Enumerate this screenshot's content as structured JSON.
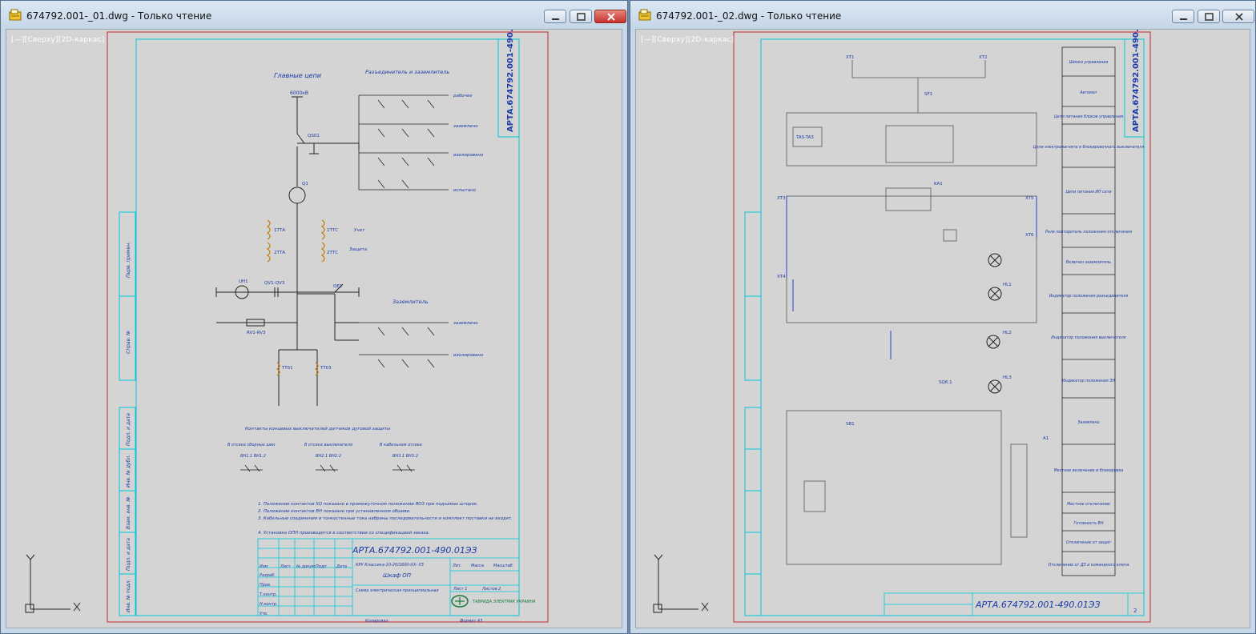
{
  "windows": [
    {
      "title": "674792.001-_01.dwg - Только чтение",
      "view_label": "[—][Сверху][2D-каркас]",
      "drawing": {
        "stamp_code": "АРТА.674792.001-490.01ЭЗ",
        "title_main": "Главные цепи",
        "title_switches": "Разъединитель и заземлитель",
        "title_earth": "Заземлитель",
        "title_contacts": "Контакты концевых выключателей датчиков дуговой защиты",
        "bus_label": "6000кВ",
        "lines_top": [
          "рабочее",
          "заземлено",
          "изолировано",
          "испытано"
        ],
        "lines_bottom": [
          "заземлено",
          "изолировано"
        ],
        "tt_labels": [
          "1ТТА",
          "2ТТА",
          "1ТТС",
          "2ТТС"
        ],
        "meas_labels": [
          "Учет",
          "Защита"
        ],
        "device_labels": [
          "QS01",
          "Q1",
          "QE1",
          "UH1",
          "QV1-QV3",
          "RV1-RV3",
          "TT01",
          "TT03"
        ],
        "contact_groups": [
          "В отсеке сборных шин",
          "В отсеке выключателя",
          "В кабельном отсеке"
        ],
        "contact_tags": [
          "ВН1.1 ВН1.2",
          "ВН2.1 ВН2.2",
          "ВН3.1 ВН3.2"
        ],
        "notes": [
          "1. Положение контактов SQ показано в промежуточном положении ЯОЗ при подъемах шторок.",
          "2. Положение контактов ВН показано при установленном обшиве.",
          "3. Кабельные соединения и тонкостенные тока набраны последовательности и комплект поставки не входят.",
          "4. Установка ОПН производится в соответствии со спецификацией заказа."
        ],
        "stamp_rows": [
          "Разраб.",
          "Пров.",
          "Т.контр.",
          "Н.контр.",
          "Утв."
        ],
        "stamp_head": [
          "Изм",
          "Лист",
          "№ докум.",
          "Подп.",
          "Дата"
        ],
        "stamp_org": "КРУ Классика-10-20/1600-ХХ- УЗ",
        "stamp_name": "Шкаф ОП",
        "stamp_sub": "Схема электрическая принципиальная",
        "stamp_cols": [
          "Лит.",
          "Масса",
          "Масштаб"
        ],
        "stamp_sheet": [
          "Лист 1",
          "Листов 2"
        ],
        "company": "ТАВРИДА ЭЛЕКТРИК УКРАИНА",
        "copied": "Копировал",
        "format": "Формат А3",
        "side_labels": [
          "Перв. примен.",
          "Справ. №",
          "Подп. и дата",
          "Инв. № дубл.",
          "Взам. инв. №",
          "Подп. и дата",
          "Инв. № подл."
        ]
      }
    },
    {
      "title": "674792.001-_02.dwg - Только чтение",
      "view_label": "[—][Сверху][2D-каркас]",
      "drawing": {
        "stamp_code": "АРТА.674792.001-490.01ЭЗ",
        "sheet": "2",
        "right_table": [
          "Шинки управления",
          "Автомат",
          "Цепи питания блоков управления",
          "Цепи электромагнита и блокировочного выключателя",
          "Цепи питания ИП сети",
          "Реле повторитель положения отключения",
          "Включен заземлитель",
          "Индикатор положения разъединителя",
          "Индикатор положения выключателя",
          "Индикатор положения ЗН",
          "Заземлено",
          "Местное включение и блокировка",
          "Местное отключение",
          "Готовность ВН",
          "Отключение от защит",
          "Отключение от ДЗ и командного ключа"
        ],
        "labels": [
          "SF1",
          "TAS-TA3",
          "KA1",
          "XT1",
          "XT2",
          "XT3",
          "XT4",
          "XT5",
          "XT6",
          "HL1",
          "HL2",
          "HL3",
          "SB1",
          "SQ6.1",
          "A1"
        ]
      }
    }
  ],
  "buttons": {
    "minimize": "minimize",
    "maximize": "maximize",
    "close": "close"
  },
  "colors": {
    "title_bg": "#c9d8e8",
    "canvas_bg": "#d4d4d4",
    "frame_red": "#c0282e",
    "frame_cyan": "#00c8d8",
    "wire_blue": "#2a3fd0",
    "text_blue": "#1a3aa8",
    "close_red": "#c8322d"
  },
  "icons": [
    "autocad-dwg-icon",
    "minimize-icon",
    "maximize-icon",
    "close-icon",
    "ucs-axis-icon"
  ]
}
